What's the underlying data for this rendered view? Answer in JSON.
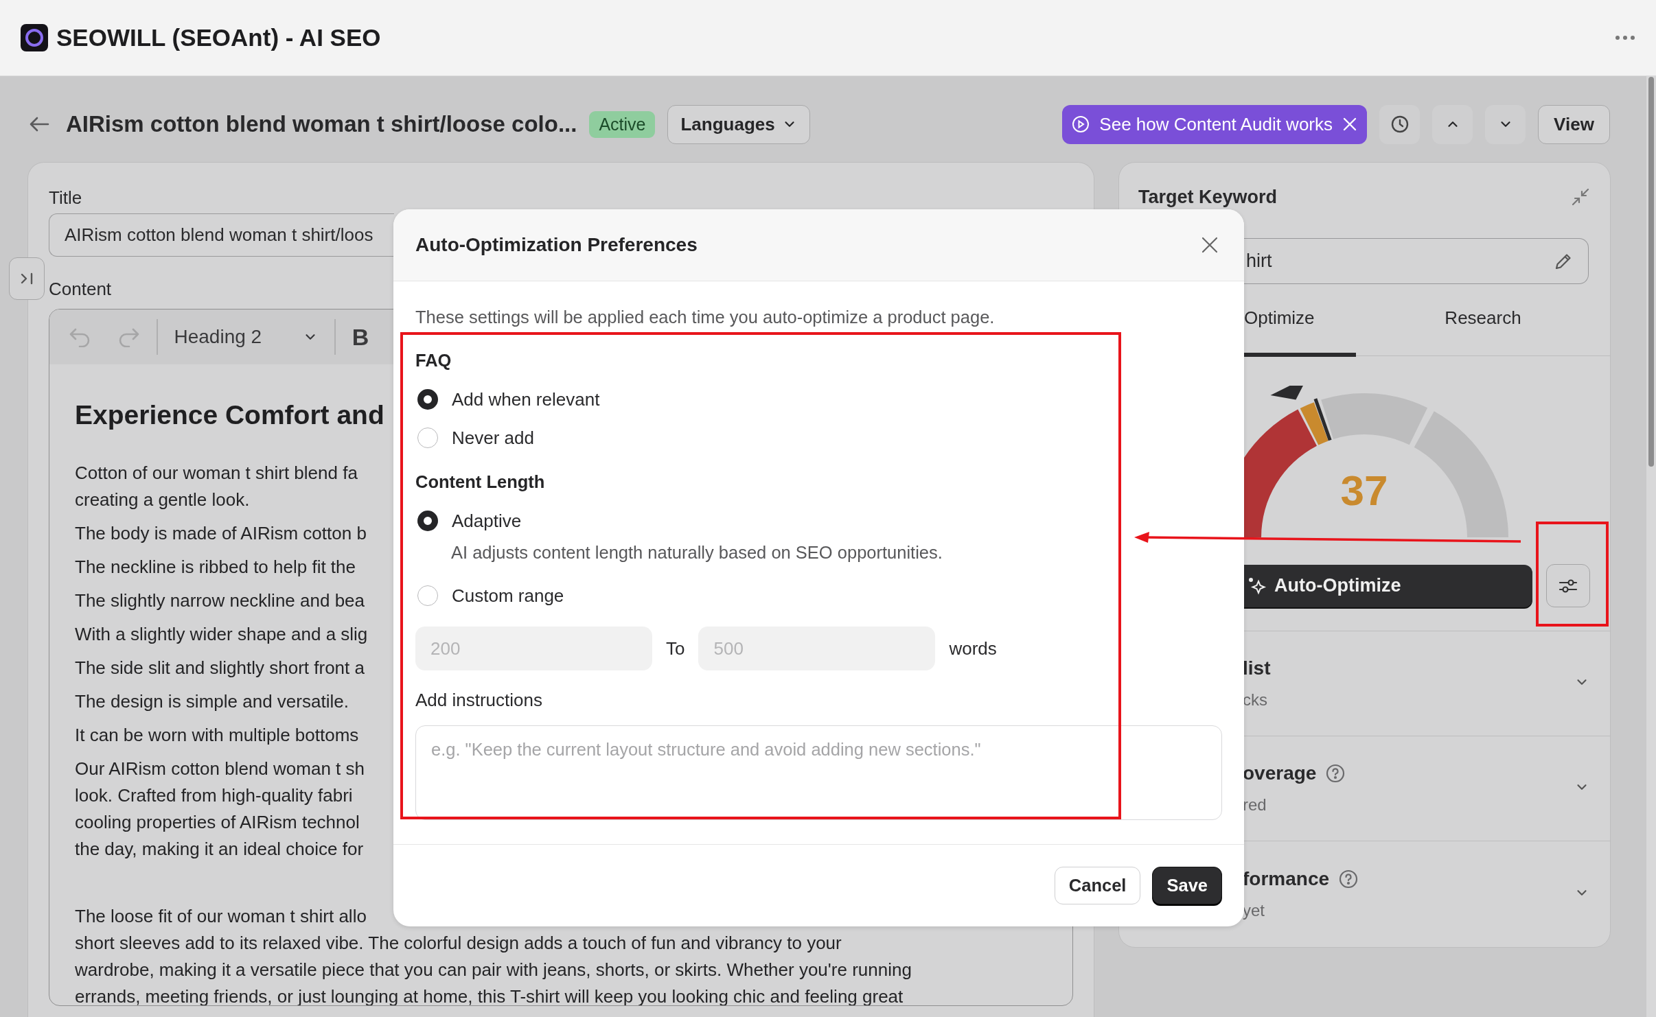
{
  "app": {
    "title": "SEOWILL (SEOAnt) - AI SEO"
  },
  "toolbar": {
    "page_title": "AIRism cotton blend woman t shirt/loose colo...",
    "status": "Active",
    "languages_button": "Languages",
    "guide_button": "See how Content Audit works",
    "view_button": "View"
  },
  "editor": {
    "title_label": "Title",
    "title_value": "AIRism cotton blend woman t shirt/loos",
    "content_label": "Content",
    "block_style": "Heading 2",
    "bold_button": "B",
    "heading": "Experience Comfort and",
    "paragraphs": [
      {
        "lines": [
          "Cotton of our woman t shirt blend fa",
          "creating a gentle look."
        ]
      },
      {
        "lines": [
          "The body is made of AIRism cotton b"
        ]
      },
      {
        "lines": [
          "The neckline is ribbed to help fit the"
        ]
      },
      {
        "lines": [
          "The slightly narrow neckline and bea"
        ]
      },
      {
        "lines": [
          "With a slightly wider shape and a slig"
        ]
      },
      {
        "lines": [
          "The side slit and slightly short front a"
        ]
      },
      {
        "lines": [
          "The design is simple and versatile."
        ]
      },
      {
        "lines": [
          "It can be worn with multiple bottoms"
        ]
      },
      {
        "lines": [
          "Our AIRism cotton blend woman t sh",
          "look. Crafted from high-quality fabri",
          "cooling properties of AIRism technol",
          "the day, making it an ideal choice for"
        ]
      },
      {
        "lines": [
          "The loose fit of our woman t shirt allo",
          "short sleeves add to its relaxed vibe. The colorful design adds a touch of fun and vibrancy to your",
          "wardrobe, making it a versatile piece that you can pair with jeans, shorts, or skirts. Whether you're running",
          "errands, meeting friends, or just lounging at home, this T-shirt will keep you looking chic and feeling great"
        ]
      }
    ]
  },
  "keyword_panel": {
    "title": "Target Keyword",
    "keyword": "hirt",
    "tabs": [
      {
        "label": "Optimize",
        "selected": true
      },
      {
        "label": "Research",
        "selected": false
      }
    ],
    "score": "37",
    "level": 0.37,
    "auto_optimize_button": "Auto-Optimize",
    "sections": [
      {
        "title": "list",
        "subtitle": "cks",
        "help": false
      },
      {
        "title": "overage",
        "subtitle": "red",
        "help": true
      },
      {
        "title": "formance",
        "subtitle": "yet",
        "help": true
      }
    ]
  },
  "modal": {
    "title": "Auto-Optimization Preferences",
    "description": "These settings will be applied each time you auto-optimize a product page.",
    "groups": [
      {
        "heading": "FAQ",
        "options": [
          {
            "label": "Add when relevant",
            "selected": true
          },
          {
            "label": "Never add",
            "selected": false
          }
        ]
      },
      {
        "heading": "Content Length",
        "options": [
          {
            "label": "Adaptive",
            "selected": true,
            "hint": "AI adjusts content length naturally based on SEO opportunities."
          },
          {
            "label": "Custom range",
            "selected": false
          }
        ]
      }
    ],
    "range": {
      "min_placeholder": "200",
      "separator": "To",
      "max_placeholder": "500",
      "unit": "words"
    },
    "instructions_label": "Add instructions",
    "instructions_placeholder": "e.g. \"Keep the current layout structure and avoid adding new sections.\"",
    "buttons": [
      {
        "label": "Cancel",
        "kind": "secondary"
      },
      {
        "label": "Save",
        "kind": "primary"
      }
    ]
  }
}
